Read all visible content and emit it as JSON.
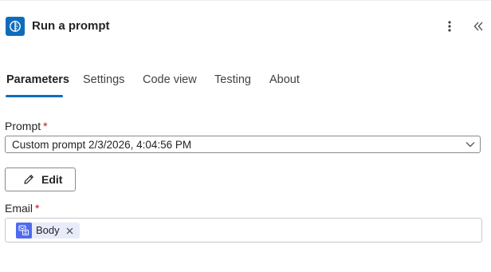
{
  "header": {
    "title": "Run a prompt",
    "icon": "ai-prompt-icon",
    "accent_color": "#0f6cbd"
  },
  "toolbar": {
    "more_icon": "more-vertical-icon",
    "collapse_icon": "double-chevron-left-icon"
  },
  "tabs": [
    {
      "label": "Parameters",
      "active": true
    },
    {
      "label": "Settings",
      "active": false
    },
    {
      "label": "Code view",
      "active": false
    },
    {
      "label": "Testing",
      "active": false
    },
    {
      "label": "About",
      "active": false
    }
  ],
  "fields": {
    "prompt": {
      "label": "Prompt",
      "required_mark": "*",
      "value": "Custom prompt 2/3/2026, 4:04:56 PM"
    },
    "edit_button": {
      "label": "Edit",
      "icon": "pencil-icon"
    },
    "email": {
      "label": "Email",
      "required_mark": "*",
      "token": {
        "label": "Body",
        "icon": "dynamic-content-icon",
        "color": "#4f6bed"
      }
    }
  },
  "colors": {
    "required": "#c50f1f",
    "tab_underline": "#0f6cbd"
  }
}
